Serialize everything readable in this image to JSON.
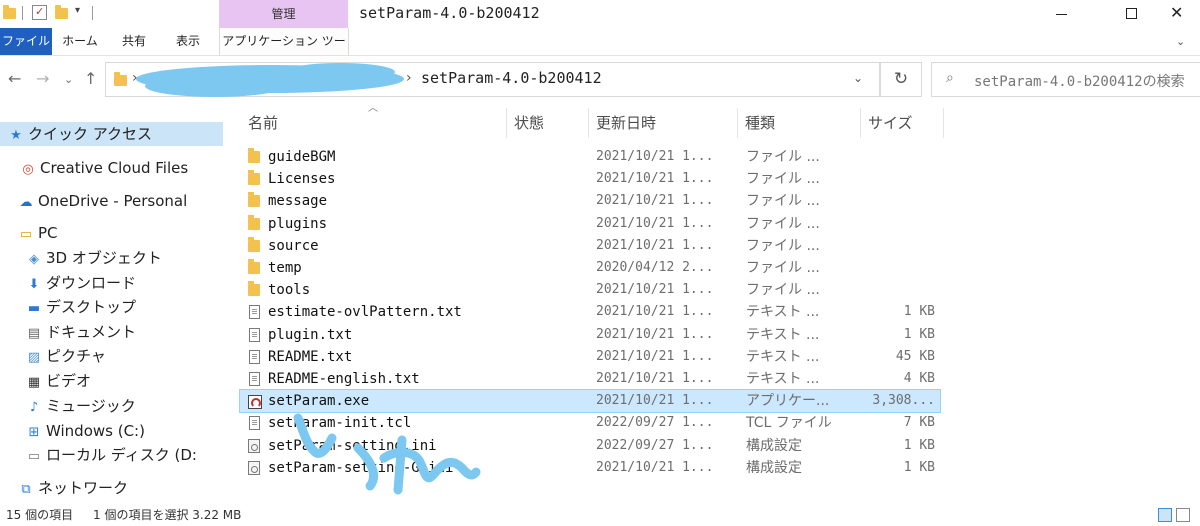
{
  "window": {
    "title": "setParam-4.0-b200412",
    "manage_tab": "管理"
  },
  "ribbon": {
    "tabs": [
      {
        "label": "ファイル"
      },
      {
        "label": "ホーム"
      },
      {
        "label": "共有"
      },
      {
        "label": "表示"
      },
      {
        "label": "アプリケーション ツール"
      }
    ]
  },
  "address": {
    "path_current": "setParam-4.0-b200412",
    "search_placeholder": "setParam-4.0-b200412の検索"
  },
  "nav": {
    "items": [
      {
        "label": "クイック アクセス"
      },
      {
        "label": "Creative Cloud Files"
      },
      {
        "label": "OneDrive - Personal"
      },
      {
        "label": "PC"
      },
      {
        "label": "3D オブジェクト"
      },
      {
        "label": "ダウンロード"
      },
      {
        "label": "デスクトップ"
      },
      {
        "label": "ドキュメント"
      },
      {
        "label": "ピクチャ"
      },
      {
        "label": "ビデオ"
      },
      {
        "label": "ミュージック"
      },
      {
        "label": "Windows (C:)"
      },
      {
        "label": "ローカル ディスク (D:"
      },
      {
        "label": "ネットワーク"
      }
    ]
  },
  "columns": {
    "name": "名前",
    "status": "状態",
    "date": "更新日時",
    "type": "種類",
    "size": "サイズ"
  },
  "files": [
    {
      "name": "guideBGM",
      "date": "2021/10/21 1...",
      "type": "ファイル ...",
      "size": "",
      "icon": "folder-icon"
    },
    {
      "name": "Licenses",
      "date": "2021/10/21 1...",
      "type": "ファイル ...",
      "size": "",
      "icon": "folder-icon"
    },
    {
      "name": "message",
      "date": "2021/10/21 1...",
      "type": "ファイル ...",
      "size": "",
      "icon": "folder-icon"
    },
    {
      "name": "plugins",
      "date": "2021/10/21 1...",
      "type": "ファイル ...",
      "size": "",
      "icon": "folder-icon"
    },
    {
      "name": "source",
      "date": "2021/10/21 1...",
      "type": "ファイル ...",
      "size": "",
      "icon": "folder-icon"
    },
    {
      "name": "temp",
      "date": "2020/04/12 2...",
      "type": "ファイル ...",
      "size": "",
      "icon": "folder-icon"
    },
    {
      "name": "tools",
      "date": "2021/10/21 1...",
      "type": "ファイル ...",
      "size": "",
      "icon": "folder-icon"
    },
    {
      "name": "estimate-ovlPattern.txt",
      "date": "2021/10/21 1...",
      "type": "テキスト ...",
      "size": "1 KB",
      "icon": "text-file-icon"
    },
    {
      "name": "plugin.txt",
      "date": "2021/10/21 1...",
      "type": "テキスト ...",
      "size": "1 KB",
      "icon": "text-file-icon"
    },
    {
      "name": "README.txt",
      "date": "2021/10/21 1...",
      "type": "テキスト ...",
      "size": "45 KB",
      "icon": "text-file-icon"
    },
    {
      "name": "README-english.txt",
      "date": "2021/10/21 1...",
      "type": "テキスト ...",
      "size": "4 KB",
      "icon": "text-file-icon"
    },
    {
      "name": "setParam.exe",
      "date": "2021/10/21 1...",
      "type": "アプリケー...",
      "size": "3,308...",
      "icon": "exe-icon",
      "selected": true
    },
    {
      "name": "setParam-init.tcl",
      "date": "2022/09/27 1...",
      "type": "TCL ファイル",
      "size": "7 KB",
      "icon": "text-file-icon"
    },
    {
      "name": "setParam-setting.ini",
      "date": "2022/09/27 1...",
      "type": "構成設定",
      "size": "1 KB",
      "icon": "config-file-icon"
    },
    {
      "name": "setParam-setting-G.ini",
      "date": "2021/10/21 1...",
      "type": "構成設定",
      "size": "1 KB",
      "icon": "config-file-icon"
    }
  ],
  "status": {
    "count": "15 個の項目",
    "selected": "1 個の項目を選択 3.22 MB"
  },
  "colors": {
    "file_tab": "#1f5fbf",
    "manage_tab": "#e7c4f1",
    "selection": "#cce8ff",
    "quick_access_highlight": "#cce4f7",
    "scribble": "#7cc8f0"
  }
}
